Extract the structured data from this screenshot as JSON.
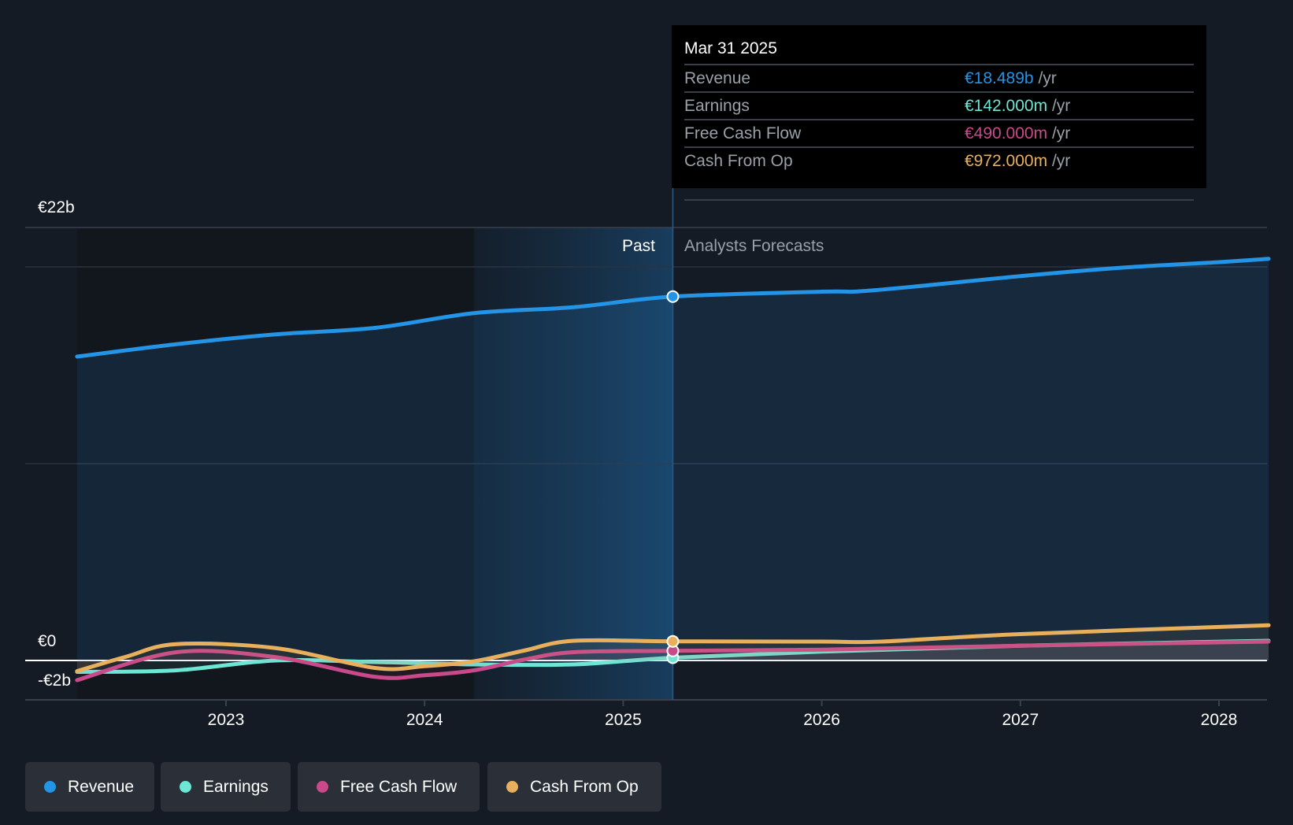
{
  "tooltip": {
    "date": "Mar 31 2025",
    "rows": [
      {
        "label": "Revenue",
        "value": "€18.489b",
        "unit": "/yr",
        "color": "#2394e6"
      },
      {
        "label": "Earnings",
        "value": "€142.000m",
        "unit": "/yr",
        "color": "#6ee6d6"
      },
      {
        "label": "Free Cash Flow",
        "value": "€490.000m",
        "unit": "/yr",
        "color": "#c94a8a"
      },
      {
        "label": "Cash From Op",
        "value": "€972.000m",
        "unit": "/yr",
        "color": "#e8b05c"
      }
    ]
  },
  "chart_data": {
    "type": "line",
    "y_axis_labels": {
      "top": "€22b",
      "zero": "€0",
      "bottom": "-€2b"
    },
    "ylim": [
      -2,
      22
    ],
    "xlim": [
      2022.25,
      2028.25
    ],
    "x_ticks": [
      "2023",
      "2024",
      "2025",
      "2026",
      "2027",
      "2028"
    ],
    "x_tick_values": [
      2023,
      2024,
      2025,
      2026,
      2027,
      2028
    ],
    "past_label": "Past",
    "forecast_label": "Analysts Forecasts",
    "divider_x": 2025.25,
    "highlight_start_x": 2024.25,
    "series": [
      {
        "name": "Revenue",
        "color": "#2394e6",
        "x": [
          2022.25,
          2022.75,
          2023.25,
          2023.75,
          2024.25,
          2024.75,
          2025.25,
          2026.0,
          2026.25,
          2027.0,
          2027.5,
          2028.0,
          2028.25
        ],
        "y": [
          15.44,
          16.07,
          16.57,
          16.9,
          17.65,
          17.95,
          18.489,
          18.74,
          18.8,
          19.53,
          19.95,
          20.24,
          20.41
        ]
      },
      {
        "name": "Earnings",
        "color": "#6ee6d6",
        "x": [
          2022.25,
          2022.75,
          2023.25,
          2023.75,
          2024.25,
          2024.75,
          2025.25,
          2026.0,
          2027.0,
          2028.25
        ],
        "y": [
          -0.58,
          -0.5,
          0.0,
          -0.08,
          -0.2,
          -0.2,
          0.142,
          0.45,
          0.75,
          1.0
        ]
      },
      {
        "name": "Free Cash Flow",
        "color": "#c94a8a",
        "x": [
          2022.25,
          2022.75,
          2023.25,
          2023.75,
          2024.0,
          2024.25,
          2024.5,
          2024.75,
          2025.25,
          2026.0,
          2027.0,
          2028.25
        ],
        "y": [
          -1.0,
          0.42,
          0.17,
          -0.83,
          -0.75,
          -0.5,
          0.04,
          0.42,
          0.49,
          0.55,
          0.75,
          0.96
        ]
      },
      {
        "name": "Cash From Op",
        "color": "#e8b05c",
        "x": [
          2022.25,
          2022.5,
          2022.75,
          2023.25,
          2023.75,
          2024.0,
          2024.25,
          2024.5,
          2024.75,
          2025.25,
          2026.0,
          2026.3,
          2027.0,
          2028.25
        ],
        "y": [
          -0.54,
          0.2,
          0.83,
          0.63,
          -0.38,
          -0.29,
          -0.04,
          0.5,
          1.0,
          0.972,
          0.96,
          0.96,
          1.34,
          1.79
        ]
      }
    ]
  },
  "legend": [
    {
      "label": "Revenue",
      "color": "#2394e6"
    },
    {
      "label": "Earnings",
      "color": "#6ee6d6"
    },
    {
      "label": "Free Cash Flow",
      "color": "#c94a8a"
    },
    {
      "label": "Cash From Op",
      "color": "#e8b05c"
    }
  ]
}
